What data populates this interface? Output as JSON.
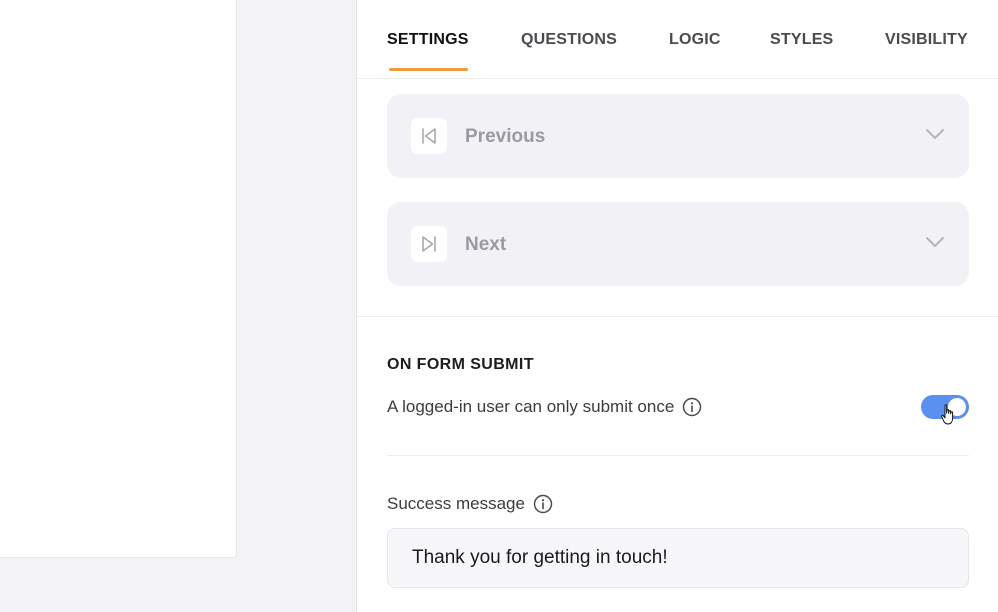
{
  "tabs": [
    {
      "label": "SETTINGS",
      "active": true
    },
    {
      "label": "QUESTIONS",
      "active": false
    },
    {
      "label": "LOGIC",
      "active": false
    },
    {
      "label": "STYLES",
      "active": false
    },
    {
      "label": "VISIBILITY",
      "active": false
    }
  ],
  "navigation": {
    "previous_label": "Previous",
    "previous_icon": "skip-back-icon",
    "next_label": "Next",
    "next_icon": "skip-forward-icon"
  },
  "on_submit": {
    "title": "ON FORM SUBMIT",
    "single_submit_label": "A logged-in user can only submit once",
    "single_submit_enabled": true,
    "success_message_label": "Success message",
    "success_message_value": "Thank you for getting in touch!"
  },
  "colors": {
    "accent_underline": "#f09a3a",
    "toggle_on": "#5b8ff0"
  }
}
